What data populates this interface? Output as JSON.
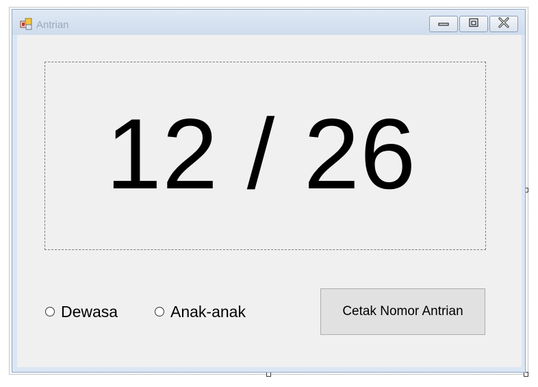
{
  "window": {
    "title": "Antrian"
  },
  "queue_display": {
    "text": "12 / 26"
  },
  "options": [
    {
      "label": "Dewasa",
      "selected": false
    },
    {
      "label": "Anak-anak",
      "selected": false
    }
  ],
  "actions": {
    "print_label": "Cetak Nomor Antrian"
  },
  "colors": {
    "titlebar": "#d6e2f0",
    "client_background": "#f0f0f0",
    "button_background": "#e1e1e1"
  }
}
